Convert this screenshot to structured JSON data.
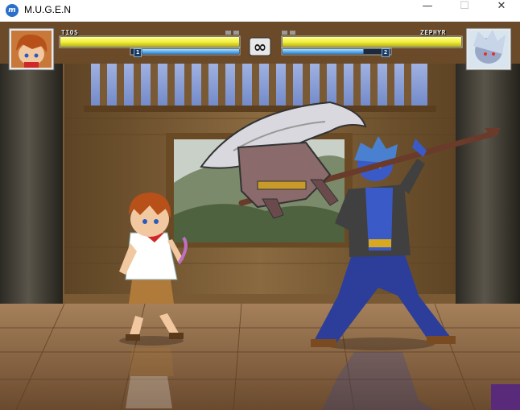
{
  "window": {
    "title": "M.U.G.E.N",
    "icon": "mugen-logo-icon",
    "minimize_glyph": "—",
    "maximize_glyph": "☐",
    "close_glyph": "✕"
  },
  "hud": {
    "player1": {
      "name": "TIOS",
      "power_level": "1",
      "life_fraction": 1.0,
      "power_fraction": 0.9
    },
    "player2": {
      "name": "ZEPHYR",
      "power_level": "2",
      "life_fraction": 1.0,
      "power_fraction": 0.75
    },
    "timer": "∞",
    "colors": {
      "life": "#f4f040",
      "power": "#3aa0e8",
      "hud_frame": "#c8c8c8"
    }
  }
}
